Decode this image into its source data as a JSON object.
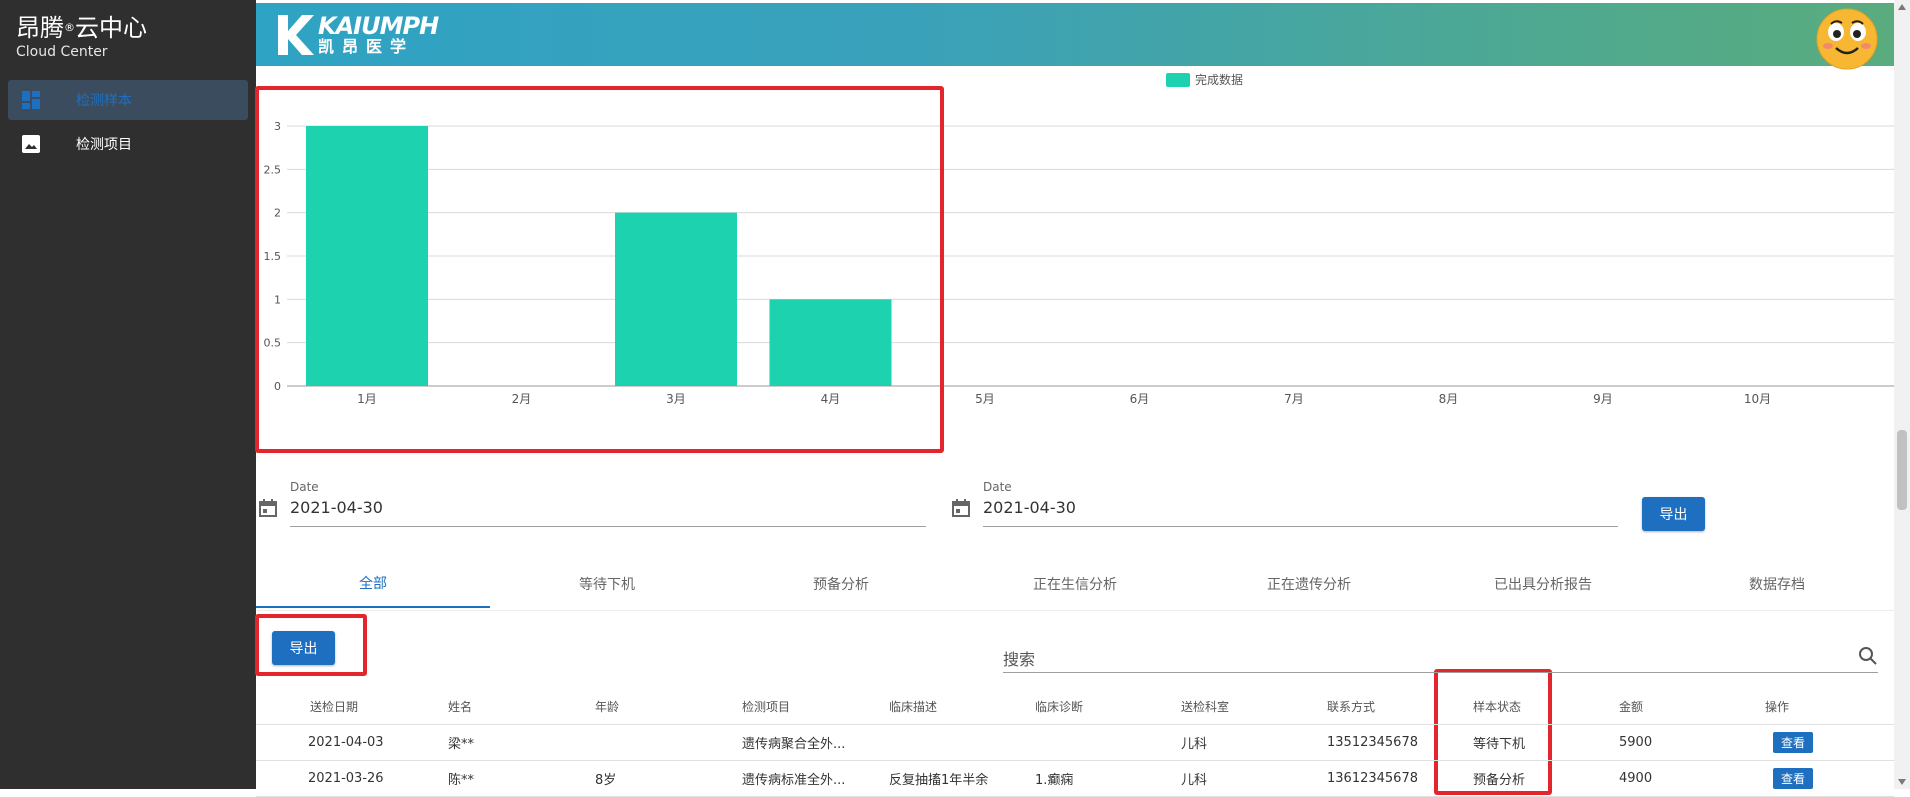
{
  "sidebar": {
    "brand_cn": "昂腾",
    "brand_reg": "®",
    "brand_cn2": "云中心",
    "brand_en": "Cloud Center",
    "items": [
      {
        "label": "检测样本",
        "icon": "dashboard-icon",
        "active": true
      },
      {
        "label": "检测项目",
        "icon": "image-icon",
        "active": false
      }
    ]
  },
  "header": {
    "logo_en": "KAIUMPH",
    "logo_cn": "凯昂医学",
    "avatar_icon": "smiley-avatar-icon"
  },
  "chart_data": {
    "type": "bar",
    "categories": [
      "1月",
      "2月",
      "3月",
      "4月",
      "5月",
      "6月",
      "7月",
      "8月",
      "9月",
      "10月"
    ],
    "series": [
      {
        "name": "完成数据",
        "values": [
          3,
          0,
          2,
          1,
          0,
          0,
          0,
          0,
          0,
          0
        ],
        "color": "#1dd2af"
      }
    ],
    "ylim": [
      0,
      3
    ],
    "yticks": [
      "0",
      "0.5",
      "1",
      "1.5",
      "2",
      "2.5",
      "3"
    ],
    "grid": true,
    "legend_position": "top-center"
  },
  "filters": {
    "start_label": "Date",
    "start_value": "2021-04-30",
    "end_label": "Date",
    "end_value": "2021-04-30",
    "export_label": "导出"
  },
  "tabs": [
    "全部",
    "等待下机",
    "预备分析",
    "正在生信分析",
    "正在遗传分析",
    "已出具分析报告",
    "数据存档"
  ],
  "table_toolbar": {
    "export_label": "导出",
    "search_placeholder": "搜索"
  },
  "table": {
    "columns": [
      "送检日期",
      "姓名",
      "年龄",
      "检测项目",
      "临床描述",
      "临床诊断",
      "送检科室",
      "联系方式",
      "样本状态",
      "金额",
      "操作"
    ],
    "rows": [
      [
        "2021-04-03",
        "梁**",
        "",
        "遗传病聚合全外...",
        "",
        "",
        "儿科",
        "13512345678",
        "等待下机",
        "5900",
        "查看"
      ],
      [
        "2021-03-26",
        "陈**",
        "8岁",
        "遗传病标准全外...",
        "反复抽搐1年半余",
        "1.癫痫",
        "儿科",
        "13612345678",
        "预备分析",
        "4900",
        "查看"
      ]
    ]
  },
  "colors": {
    "primary": "#1e6fbf",
    "bar": "#1dd2af",
    "highlight": "#e3262c",
    "sidebar_bg": "#2f2f2f"
  }
}
